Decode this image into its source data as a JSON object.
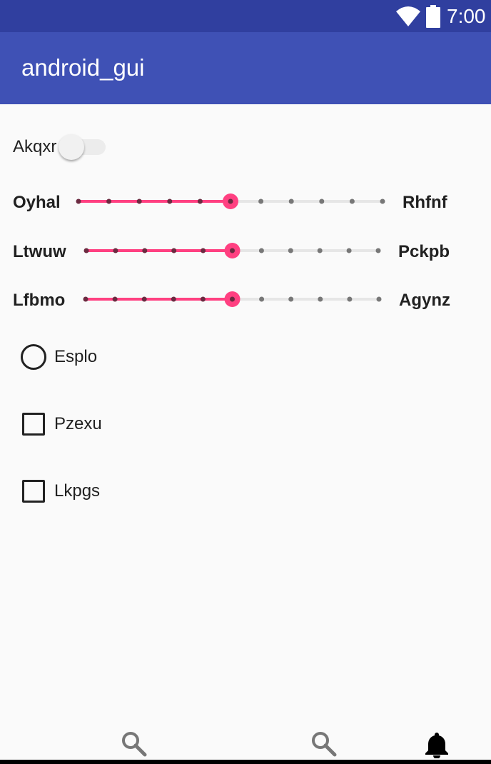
{
  "status_bar": {
    "time": "7:00",
    "icons": [
      "wifi-icon",
      "battery-icon"
    ]
  },
  "app_bar": {
    "title": "android_gui"
  },
  "switch": {
    "label": "Akqxr",
    "checked": false
  },
  "sliders": [
    {
      "start_label": "Oyhal",
      "end_label": "Rhfnf",
      "value": 5,
      "max": 10
    },
    {
      "start_label": "Ltwuw",
      "end_label": "Pckpb",
      "value": 5,
      "max": 10
    },
    {
      "start_label": "Lfbmo",
      "end_label": "Agynz",
      "value": 5,
      "max": 10
    }
  ],
  "radio": {
    "label": "Esplo",
    "checked": false
  },
  "checkboxes": [
    {
      "label": "Pzexu",
      "checked": false
    },
    {
      "label": "Lkpgs",
      "checked": false
    }
  ],
  "bottom_nav": {
    "items": [
      {
        "icon": "search-icon",
        "active": false
      },
      {
        "icon": "search-icon",
        "active": false
      },
      {
        "icon": "bell-icon",
        "active": true
      }
    ]
  },
  "colors": {
    "primary": "#3f51b5",
    "primary_dark": "#303f9f",
    "accent": "#ff4081"
  }
}
